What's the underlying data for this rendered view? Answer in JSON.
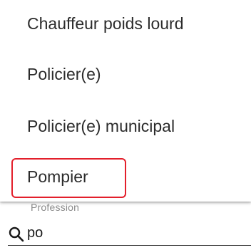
{
  "dropdown": {
    "options": [
      {
        "label": "Chauffeur poids lourd"
      },
      {
        "label": "Policier(e)"
      },
      {
        "label": "Policier(e) municipal"
      },
      {
        "label": "Pompier"
      }
    ],
    "highlight_color": "#e31f2b"
  },
  "field": {
    "label": "Profession",
    "value": "po",
    "icon": "search-icon"
  }
}
